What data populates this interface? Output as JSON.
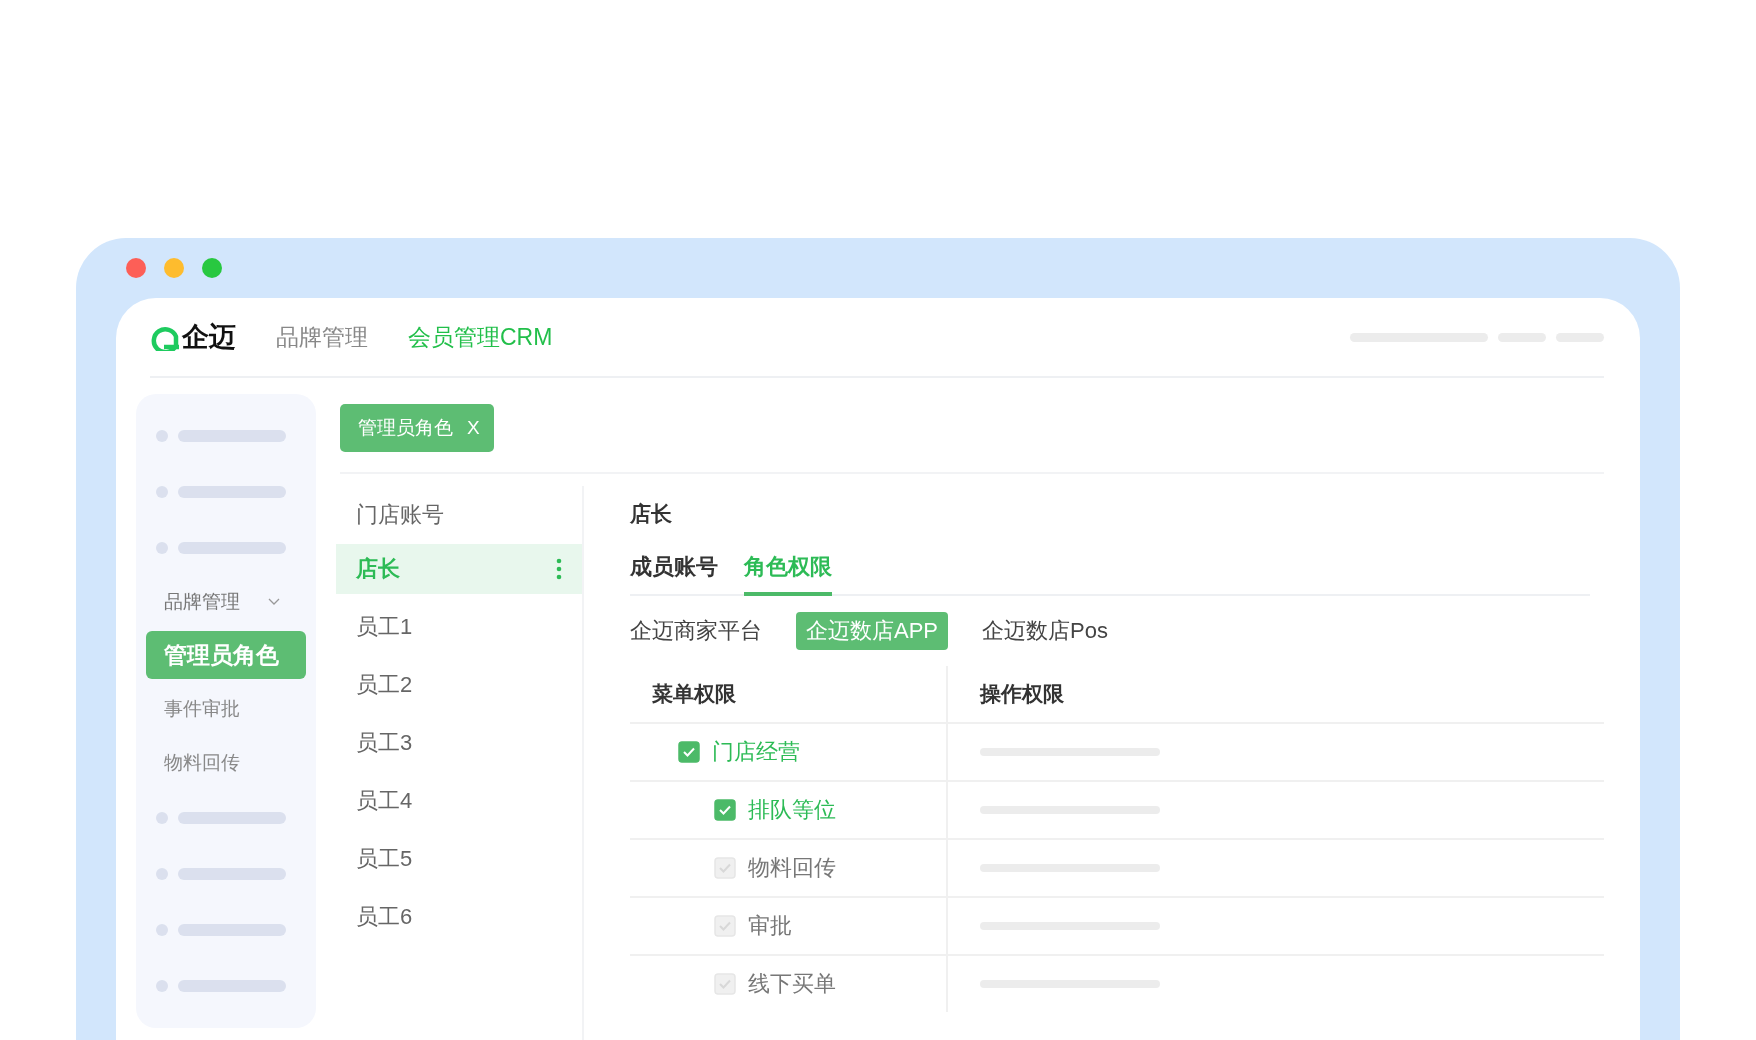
{
  "header": {
    "logo_text": "企迈",
    "nav": [
      {
        "label": "品牌管理",
        "selected": false
      },
      {
        "label": "会员管理CRM",
        "selected": true
      }
    ]
  },
  "sidebar": {
    "items": [
      {
        "kind": "skeleton"
      },
      {
        "kind": "skeleton"
      },
      {
        "kind": "skeleton"
      },
      {
        "kind": "group",
        "label": "品牌管理",
        "expanded": true
      },
      {
        "kind": "item",
        "label": "管理员角色",
        "selected": true
      },
      {
        "kind": "item",
        "label": "事件审批",
        "selected": false
      },
      {
        "kind": "item",
        "label": "物料回传",
        "selected": false
      },
      {
        "kind": "skeleton"
      },
      {
        "kind": "skeleton"
      },
      {
        "kind": "skeleton"
      },
      {
        "kind": "skeleton"
      }
    ]
  },
  "open_tabs": [
    {
      "label": "管理员角色",
      "close": "X"
    }
  ],
  "roles": {
    "title": "门店账号",
    "items": [
      {
        "label": "店长",
        "selected": true
      },
      {
        "label": "员工1",
        "selected": false
      },
      {
        "label": "员工2",
        "selected": false
      },
      {
        "label": "员工3",
        "selected": false
      },
      {
        "label": "员工4",
        "selected": false
      },
      {
        "label": "员工5",
        "selected": false
      },
      {
        "label": "员工6",
        "selected": false
      }
    ]
  },
  "detail": {
    "title": "店长",
    "tabs": [
      {
        "label": "成员账号",
        "selected": false
      },
      {
        "label": "角色权限",
        "selected": true
      }
    ],
    "platforms": [
      {
        "label": "企迈商家平台",
        "selected": false
      },
      {
        "label": "企迈数店APP",
        "selected": true
      },
      {
        "label": "企迈数店Pos",
        "selected": false
      }
    ],
    "table": {
      "columns": [
        "菜单权限",
        "操作权限"
      ],
      "rows": [
        {
          "label": "门店经营",
          "checked": true,
          "disabled": false,
          "children": [
            {
              "label": "排队等位",
              "checked": true,
              "disabled": false
            },
            {
              "label": "物料回传",
              "checked": true,
              "disabled": true
            },
            {
              "label": "审批",
              "checked": true,
              "disabled": true
            },
            {
              "label": "线下买单",
              "checked": true,
              "disabled": true
            }
          ]
        }
      ]
    }
  }
}
